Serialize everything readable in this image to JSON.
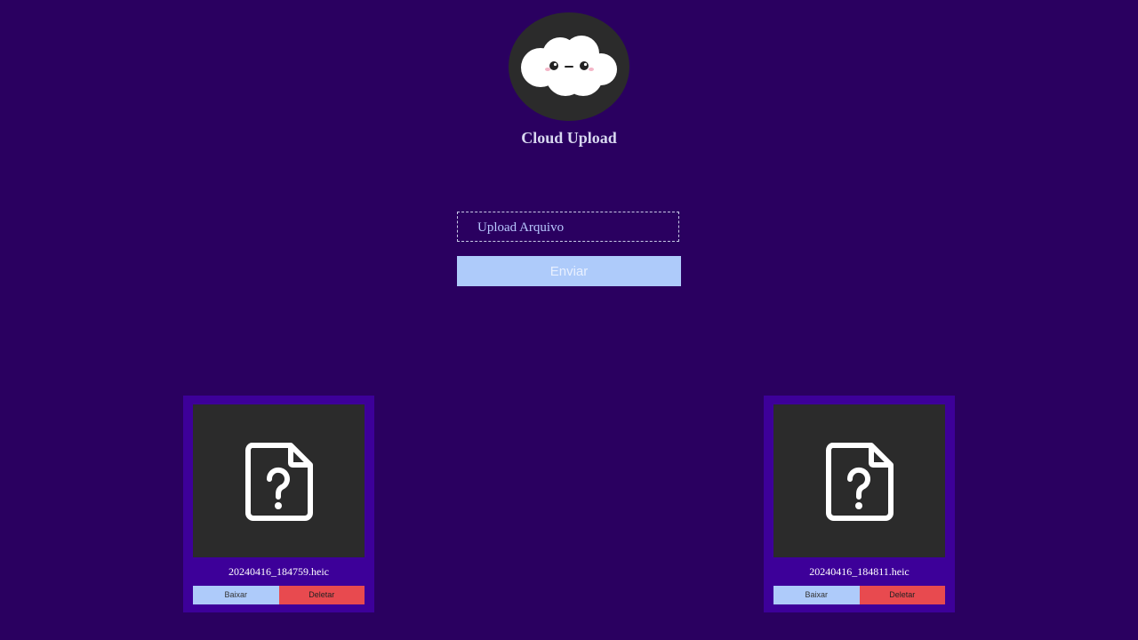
{
  "header": {
    "logo_icon": "smiling-cloud-icon",
    "title": "Cloud Upload"
  },
  "upload": {
    "field_label": "Upload Arquivo",
    "submit_label": "Enviar"
  },
  "files": [
    {
      "name": "20240416_184759.heic",
      "thumbnail_icon": "unknown-file-icon",
      "download_label": "Baixar",
      "delete_label": "Deletar"
    },
    {
      "name": "20240416_184811.heic",
      "thumbnail_icon": "unknown-file-icon",
      "download_label": "Baixar",
      "delete_label": "Deletar"
    }
  ],
  "colors": {
    "background": "#2a0060",
    "card": "#3d0099",
    "thumbnail": "#2b2b2b",
    "primary": "#aecbfa",
    "danger": "#e84a4f"
  }
}
